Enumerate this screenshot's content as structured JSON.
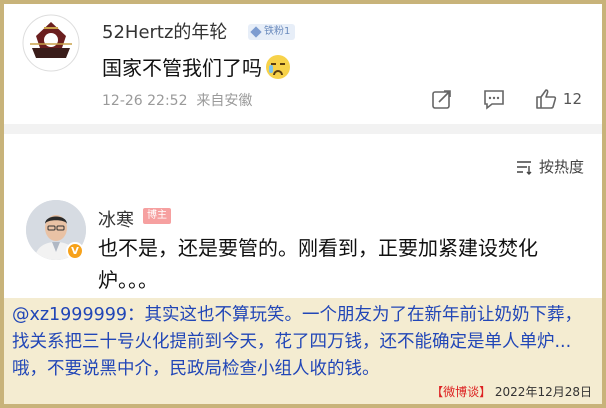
{
  "post": {
    "username": "52Hertz的年轮",
    "fan_badge": "铁粉1",
    "text": "国家不管我们了吗",
    "timestamp": "12-26 22:52",
    "location": "来自安徽",
    "like_count": "12",
    "emoji": "crying-face"
  },
  "comments": {
    "sort_label": "按热度",
    "items": [
      {
        "name": "冰寒",
        "tag": "博主",
        "text": "也不是，还是要管的。刚看到，正要加紧建设焚化炉。。。"
      }
    ]
  },
  "caption": {
    "text": "@xz1999999：其实这也不算玩笑。一个朋友为了在新年前让奶奶下葬，找关系把三十号火化提前到今天，花了四万钱，还不能确定是单人单炉...哦，不要说黑中介，民政局检查小组人收的钱。",
    "source_tag": "【微博谈】",
    "source_date": "2022年12月28日"
  },
  "colors": {
    "caption_bg": "#f4ecd1",
    "caption_text": "#2146b7",
    "frame": "#c8b37a"
  }
}
